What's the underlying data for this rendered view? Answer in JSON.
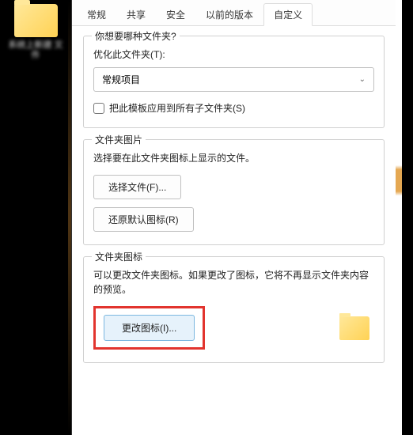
{
  "desktop": {
    "folder_label": "系统上新建\n文件"
  },
  "tabs": {
    "items": [
      {
        "label": "常规"
      },
      {
        "label": "共享"
      },
      {
        "label": "安全"
      },
      {
        "label": "以前的版本"
      },
      {
        "label": "自定义",
        "active": true
      }
    ]
  },
  "group1": {
    "title": "你想要哪种文件夹?",
    "optimize_label": "优化此文件夹(T):",
    "select_value": "常规项目",
    "apply_children_label": "把此模板应用到所有子文件夹(S)"
  },
  "group2": {
    "title": "文件夹图片",
    "desc": "选择要在此文件夹图标上显示的文件。",
    "choose_file_btn": "选择文件(F)...",
    "restore_btn": "还原默认图标(R)"
  },
  "group3": {
    "title": "文件夹图标",
    "desc": "可以更改文件夹图标。如果更改了图标，它将不再显示文件夹内容的预览。",
    "change_icon_btn": "更改图标(I)..."
  }
}
